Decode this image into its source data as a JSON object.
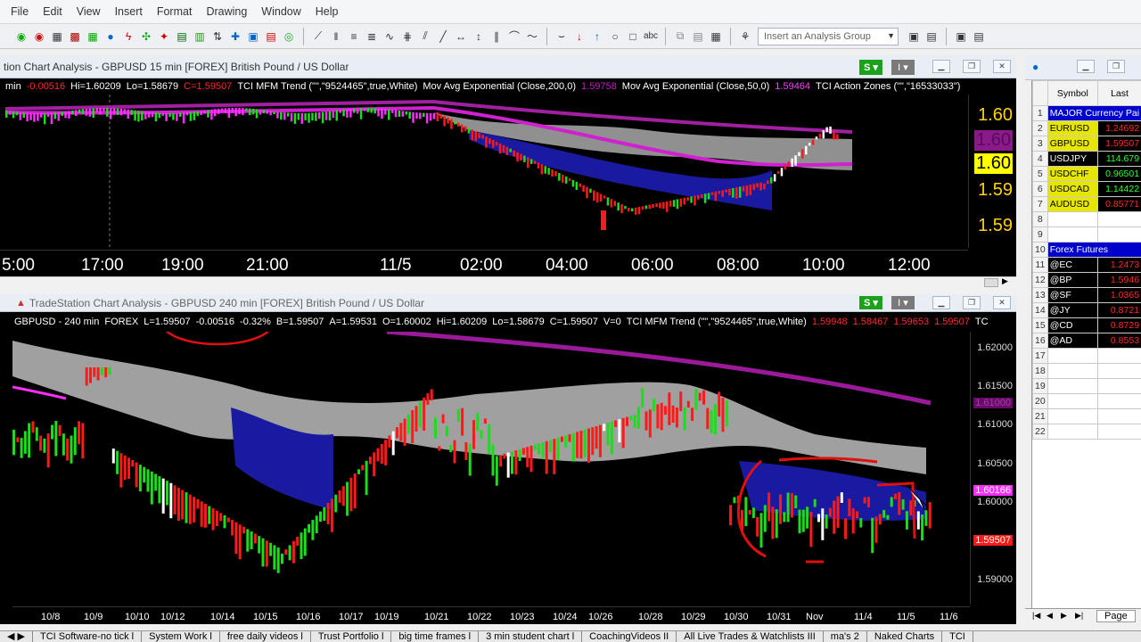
{
  "menu": [
    "File",
    "Edit",
    "View",
    "Insert",
    "Format",
    "Drawing",
    "Window",
    "Help"
  ],
  "toolbar": {
    "analysis_group_placeholder": "Insert an Analysis Group"
  },
  "chart1": {
    "title": "tion Chart Analysis - GBPUSD 15 min [FOREX] British Pound / US Dollar",
    "status": {
      "interval": "min",
      "chg": "-0.00516",
      "hi": "Hi=1.60209",
      "lo": "Lo=1.58679",
      "close": "C=1.59507",
      "mfm": "TCI MFM Trend (\"\",\"9524465\",true,White)",
      "ma200": "Mov Avg Exponential (Close,200,0)",
      "ma200v": "1.59758",
      "ma50": "Mov Avg Exponential (Close,50,0)",
      "ma50v": "1.59464",
      "zones": "TCI Action Zones (\"\",\"16533033\")"
    },
    "price_labels": [
      "1.60",
      "1.60",
      "1.60",
      "1.59",
      "1.59"
    ],
    "time_labels": [
      "5:00",
      "17:00",
      "19:00",
      "21:00",
      "11/5",
      "02:00",
      "04:00",
      "06:00",
      "08:00",
      "10:00",
      "12:00"
    ]
  },
  "chart2": {
    "title": "TradeStation Chart Analysis - GBPUSD 240 min [FOREX] British Pound / US Dollar",
    "status": {
      "sym": "GBPUSD - 240 min",
      "ex": "FOREX",
      "last": "L=1.59507",
      "chg": "-0.00516",
      "pct": "-0.32%",
      "b": "B=1.59507",
      "a": "A=1.59531",
      "o": "O=1.60002",
      "hi": "Hi=1.60209",
      "lo": "Lo=1.58679",
      "c": "C=1.59507",
      "v": "V=0",
      "mfm": "TCI MFM Trend (\"\",\"9524465\",true,White)",
      "v1": "1.59948",
      "v2": "1.58467",
      "v3": "1.59653",
      "v4": "1.59507",
      "tc": "TC"
    },
    "price_labels": [
      "1.62000",
      "1.61500",
      "1.61000",
      "1.60500",
      "1.60000",
      "1.59000"
    ],
    "marker_labels": [
      "1.60166",
      "1.59507",
      "1.61000"
    ],
    "date_labels": [
      "10/8",
      "10/9",
      "10/10",
      "10/12",
      "10/14",
      "10/15",
      "10/16",
      "10/17",
      "10/19",
      "10/21",
      "10/22",
      "10/23",
      "10/24",
      "10/26",
      "10/28",
      "10/29",
      "10/30",
      "10/31",
      "Nov",
      "11/4",
      "11/5",
      "11/6"
    ]
  },
  "watchlist": {
    "headers": [
      "Symbol",
      "Last"
    ],
    "rows": [
      {
        "n": "1",
        "sym": "MAJOR Currency Pai",
        "last": "",
        "bg": "#0000cc",
        "fg": "#ffffff"
      },
      {
        "n": "2",
        "sym": "EURUSD",
        "last": "1.24692",
        "bg": "#e6e600",
        "fg": "#000",
        "lc": "#ff2a2a"
      },
      {
        "n": "3",
        "sym": "GBPUSD",
        "last": "1.59507",
        "bg": "#e6e600",
        "fg": "#000",
        "lc": "#ff2a2a"
      },
      {
        "n": "4",
        "sym": "USDJPY",
        "last": "114.679",
        "bg": "#000",
        "fg": "#fff",
        "lc": "#33ff33"
      },
      {
        "n": "5",
        "sym": "USDCHF",
        "last": "0.96501",
        "bg": "#e6e600",
        "fg": "#000",
        "lc": "#33ff33"
      },
      {
        "n": "6",
        "sym": "USDCAD",
        "last": "1.14422",
        "bg": "#e6e600",
        "fg": "#000",
        "lc": "#33ff33"
      },
      {
        "n": "7",
        "sym": "AUDUSD",
        "last": "0.85771",
        "bg": "#e6e600",
        "fg": "#000",
        "lc": "#ff2a2a"
      },
      {
        "n": "8",
        "sym": "",
        "last": ""
      },
      {
        "n": "9",
        "sym": "",
        "last": ""
      },
      {
        "n": "10",
        "sym": "Forex Futures",
        "last": "",
        "bg": "#0000cc",
        "fg": "#ffffff"
      },
      {
        "n": "11",
        "sym": "@EC",
        "last": "1.2473",
        "bg": "#000",
        "fg": "#fff",
        "lc": "#ff2a2a"
      },
      {
        "n": "12",
        "sym": "@BP",
        "last": "1.5946",
        "bg": "#000",
        "fg": "#fff",
        "lc": "#ff2a2a"
      },
      {
        "n": "13",
        "sym": "@SF",
        "last": "1.0365",
        "bg": "#000",
        "fg": "#fff",
        "lc": "#ff2a2a"
      },
      {
        "n": "14",
        "sym": "@JY",
        "last": "0.8721",
        "bg": "#000",
        "fg": "#fff",
        "lc": "#ff2a2a"
      },
      {
        "n": "15",
        "sym": "@CD",
        "last": "0.8729",
        "bg": "#000",
        "fg": "#fff",
        "lc": "#ff2a2a"
      },
      {
        "n": "16",
        "sym": "@AD",
        "last": "0.8553",
        "bg": "#000",
        "fg": "#fff",
        "lc": "#ff2a2a"
      },
      {
        "n": "17",
        "sym": "",
        "last": ""
      },
      {
        "n": "18",
        "sym": "",
        "last": ""
      },
      {
        "n": "19",
        "sym": "",
        "last": ""
      },
      {
        "n": "20",
        "sym": "",
        "last": ""
      },
      {
        "n": "21",
        "sym": "",
        "last": ""
      },
      {
        "n": "22",
        "sym": "",
        "last": ""
      }
    ],
    "page_tab": "Page"
  },
  "bottom_tabs": [
    "TCI Software-no tick l",
    "System Work l",
    "free daily videos l",
    "Trust Portfolio l",
    "big time frames l",
    "3 min student chart l",
    "CoachingVideos II",
    "All Live Trades & Watchlists III",
    "ma's 2",
    "Naked Charts",
    "TCI"
  ]
}
